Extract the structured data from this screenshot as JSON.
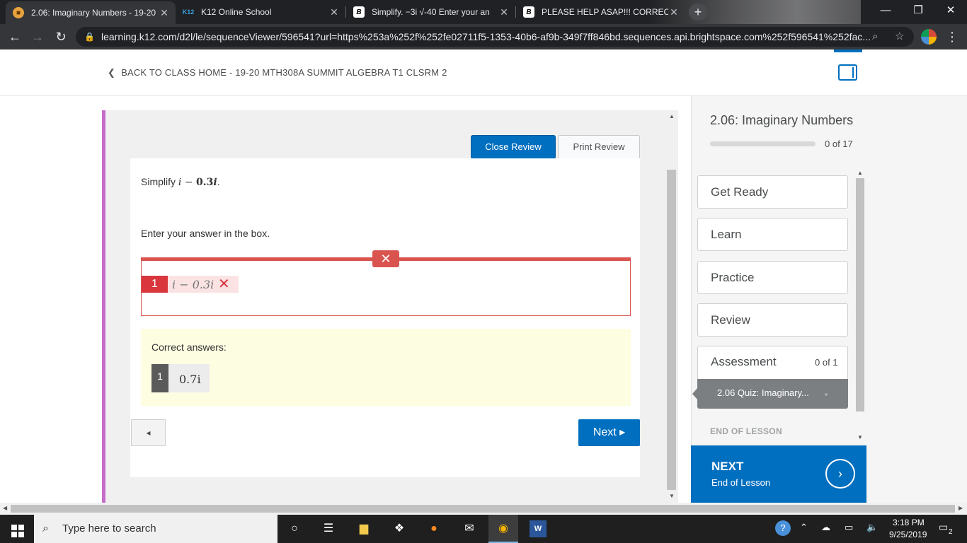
{
  "browser": {
    "tabs": [
      {
        "title": "2.06: Imaginary Numbers - 19-20",
        "favicon": "bookmark-icon"
      },
      {
        "title": "K12 Online School",
        "favicon": "k12-logo-icon"
      },
      {
        "title": "Simplify. −3i √-40  Enter your an",
        "favicon": "brainly-icon"
      },
      {
        "title": "PLEASE HELP ASAP!!! CORRECT A",
        "favicon": "brainly-icon"
      }
    ],
    "k12_favicon_text": "K12",
    "brainly_favicon_text": "B",
    "new_tab": "+",
    "url": "learning.k12.com/d2l/le/sequenceViewer/596541?url=https%253a%252f%252fe02711f5-1353-40b6-af9b-349f7ff846bd.sequences.api.brightspace.com%252f596541%252fac..."
  },
  "header": {
    "back_link": "BACK TO CLASS HOME - 19-20 MTH308A SUMMIT ALGEBRA T1 CLSRM 2"
  },
  "review": {
    "close_label": "Close Review",
    "print_label": "Print Review"
  },
  "question": {
    "prompt_prefix": "Simplify ",
    "prompt_expr_i": "i",
    "prompt_expr_minus": " − ",
    "prompt_expr_coef": "0.3",
    "prompt_expr_i2": "i",
    "prompt_suffix": ".",
    "instruction": "Enter your answer in the box.",
    "wrong_marker": "✕",
    "answer_number": "1",
    "answer_value": "i − 0.3i",
    "answer_status": "incorrect",
    "answer_x": "✕"
  },
  "correct": {
    "label": "Correct answers:",
    "number": "1",
    "value": "0.7i"
  },
  "nav": {
    "prev_label": "◂",
    "next_label": "Next ▸"
  },
  "sidebar": {
    "lesson_title": "2.06: Imaginary Numbers",
    "progress_text": "0 of 17",
    "progress_fraction": 0,
    "items": [
      "Get Ready",
      "Learn",
      "Practice",
      "Review"
    ],
    "assessment_label": "Assessment",
    "assessment_count": "0 of 1",
    "quiz_label": "2.06 Quiz: Imaginary...",
    "end_of_lesson": "END OF LESSON",
    "next_title": "NEXT",
    "next_subtitle": "End of Lesson",
    "next_arrow": "›"
  },
  "taskbar": {
    "search_placeholder": "Type here to search",
    "time": "3:18 PM",
    "date": "9/25/2019",
    "notification_count": "2"
  },
  "colors": {
    "accent_blue": "#006fbf",
    "error_red": "#d9534f",
    "frame_purple": "#c56bc9",
    "correct_bg": "#fdfde2"
  }
}
